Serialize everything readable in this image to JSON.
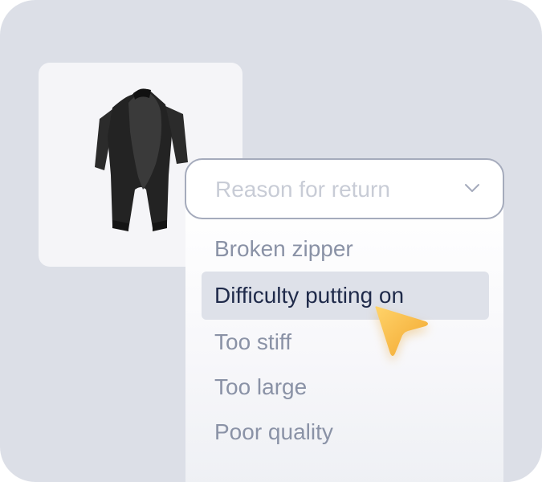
{
  "product": {
    "image_alt": "Black short-sleeve wetsuit",
    "icon": "wetsuit-image"
  },
  "return_form": {
    "select": {
      "placeholder": "Reason for return",
      "icon": "chevron-down-icon"
    },
    "options": [
      {
        "label": "Broken zipper",
        "highlighted": false
      },
      {
        "label": "Difficulty putting on",
        "highlighted": true
      },
      {
        "label": "Too stiff",
        "highlighted": false
      },
      {
        "label": "Too large",
        "highlighted": false
      },
      {
        "label": "Poor quality",
        "highlighted": false
      }
    ]
  },
  "colors": {
    "background": "#dcdfe7",
    "card": "#f5f5f8",
    "select_border": "#a5abbc",
    "placeholder_text": "#c8ccd6",
    "option_text": "#8a92a6",
    "highlight_bg": "#dee1e9",
    "highlight_text": "#1f2a4a",
    "cursor": "#f5b43a"
  },
  "cursor": {
    "icon": "pointer-cursor-icon"
  }
}
